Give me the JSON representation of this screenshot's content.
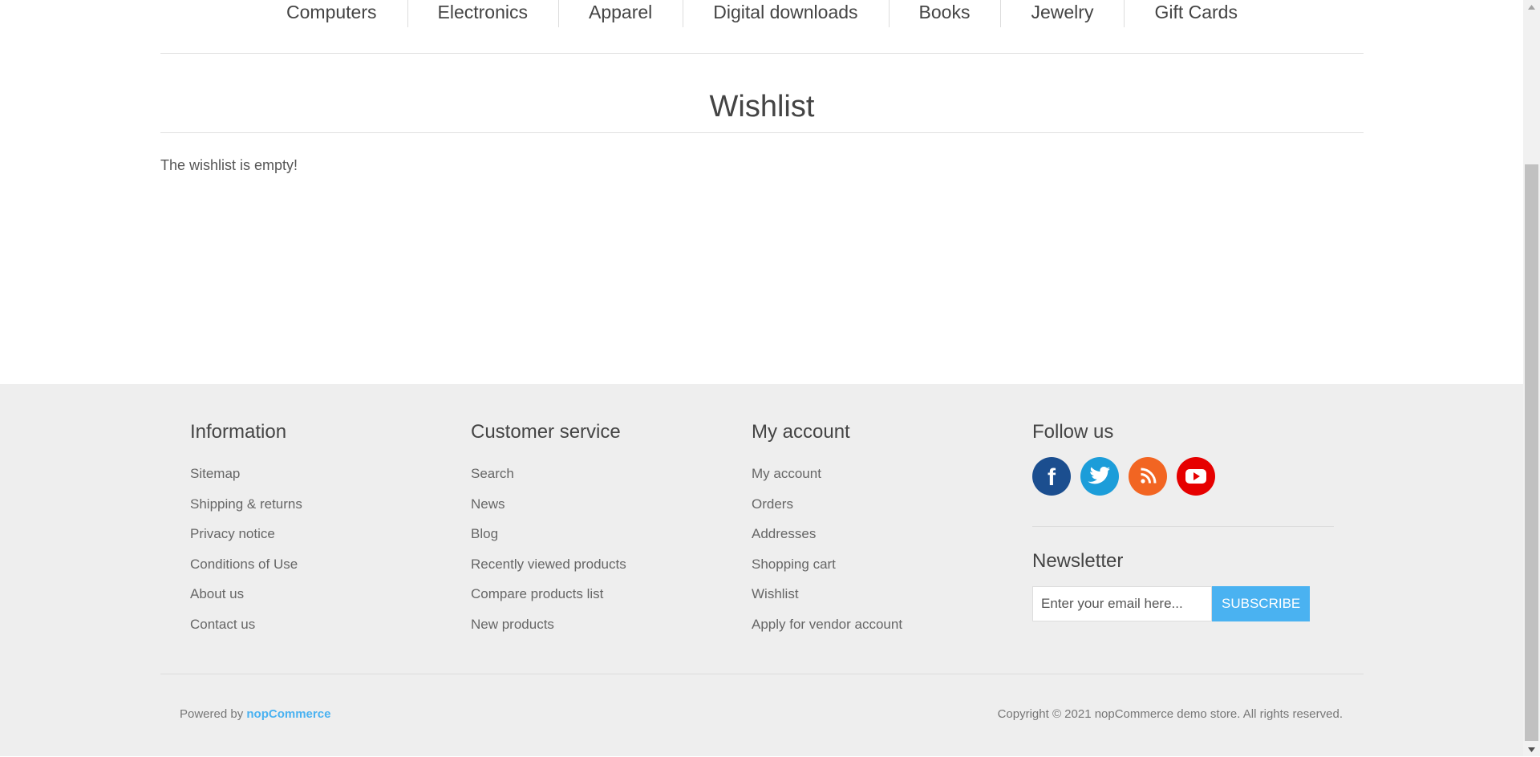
{
  "top_menu": {
    "items": [
      {
        "label": "Computers"
      },
      {
        "label": "Electronics"
      },
      {
        "label": "Apparel"
      },
      {
        "label": "Digital downloads"
      },
      {
        "label": "Books"
      },
      {
        "label": "Jewelry"
      },
      {
        "label": "Gift Cards"
      }
    ]
  },
  "page": {
    "title": "Wishlist",
    "empty_message": "The wishlist is empty!"
  },
  "footer": {
    "information": {
      "title": "Information",
      "links": [
        "Sitemap",
        "Shipping & returns",
        "Privacy notice",
        "Conditions of Use",
        "About us",
        "Contact us"
      ]
    },
    "customer_service": {
      "title": "Customer service",
      "links": [
        "Search",
        "News",
        "Blog",
        "Recently viewed products",
        "Compare products list",
        "New products"
      ]
    },
    "my_account": {
      "title": "My account",
      "links": [
        "My account",
        "Orders",
        "Addresses",
        "Shopping cart",
        "Wishlist",
        "Apply for vendor account"
      ]
    },
    "follow_us": {
      "title": "Follow us",
      "icons": [
        "facebook-icon",
        "twitter-icon",
        "rss-icon",
        "youtube-icon"
      ],
      "colors": {
        "facebook": "#1b4e8f",
        "twitter": "#1c9dd9",
        "rss": "#f26522",
        "youtube": "#e60000"
      }
    },
    "newsletter": {
      "title": "Newsletter",
      "placeholder": "Enter your email here...",
      "button_label": "SUBSCRIBE"
    },
    "powered_by_prefix": "Powered by",
    "powered_by_link": "nopCommerce",
    "copyright": "Copyright © 2021 nopCommerce demo store. All rights reserved."
  },
  "colors": {
    "accent": "#4ab2f1",
    "footer_bg": "#eeeeee"
  }
}
